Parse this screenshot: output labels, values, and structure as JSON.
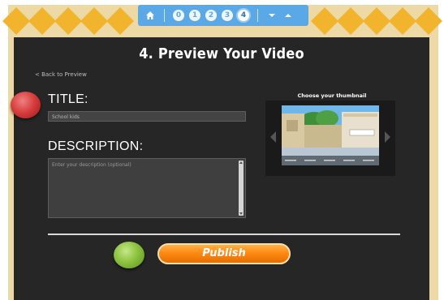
{
  "nav": {
    "steps": [
      "0",
      "1",
      "2",
      "3",
      "4"
    ],
    "active_step": "4"
  },
  "page": {
    "heading": "4. Preview Your Video",
    "back_link": "< Back to Preview"
  },
  "form": {
    "title_label": "TITLE:",
    "title_value": "School kids",
    "description_label": "DESCRIPTION:",
    "description_placeholder": "Enter your description (optional)"
  },
  "thumbnail": {
    "label": "Choose your thumbnail"
  },
  "actions": {
    "publish_label": "Publish"
  },
  "colors": {
    "panel_bg": "#262626",
    "nav_bg": "#5aa9e6",
    "diamond": "#f2b32d",
    "publish": "#ff8a12",
    "marker_red": "#d43a3a",
    "marker_green": "#8dc33e"
  }
}
